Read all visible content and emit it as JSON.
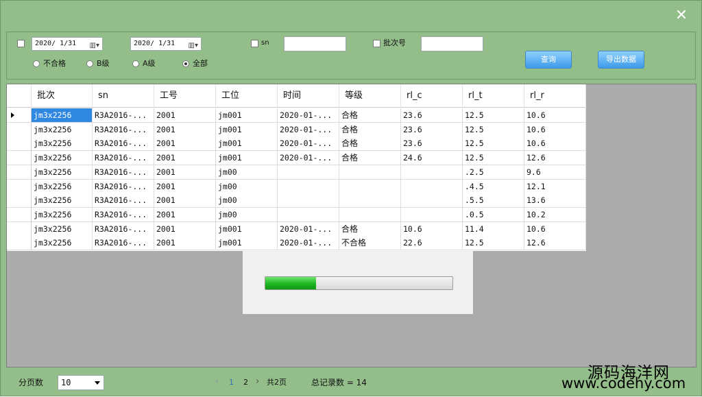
{
  "window": {
    "close_glyph": "✕"
  },
  "filter": {
    "date_start": "2020/ 1/31",
    "date_end": "2020/ 1/31",
    "sn_label": "sn",
    "sn_value": "",
    "batch_label": "批次号",
    "batch_value": "",
    "radios": [
      {
        "label": "不合格",
        "checked": false
      },
      {
        "label": "B级",
        "checked": false
      },
      {
        "label": "A级",
        "checked": false
      },
      {
        "label": "全部",
        "checked": true
      }
    ],
    "query_button": "查询",
    "export_button": "导出数据"
  },
  "grid": {
    "columns": [
      "批次",
      "sn",
      "工号",
      "工位",
      "时间",
      "等级",
      "rl_c",
      "rl_t",
      "rl_r"
    ],
    "rows": [
      [
        "jm3x2256",
        "R3A2016-...",
        "2001",
        "jm001",
        "2020-01-...",
        "合格",
        "23.6",
        "12.5",
        "10.6"
      ],
      [
        "jm3x2256",
        "R3A2016-...",
        "2001",
        "jm001",
        "2020-01-...",
        "合格",
        "23.6",
        "12.5",
        "10.6"
      ],
      [
        "jm3x2256",
        "R3A2016-...",
        "2001",
        "jm001",
        "2020-01-...",
        "合格",
        "23.6",
        "12.5",
        "10.6"
      ],
      [
        "jm3x2256",
        "R3A2016-...",
        "2001",
        "jm001",
        "2020-01-...",
        "合格",
        "24.6",
        "12.5",
        "12.6"
      ],
      [
        "jm3x2256",
        "R3A2016-...",
        "2001",
        "jm00",
        "",
        "",
        "",
        ".2.5",
        "9.6"
      ],
      [
        "jm3x2256",
        "R3A2016-...",
        "2001",
        "jm00",
        "",
        "",
        "",
        ".4.5",
        "12.1"
      ],
      [
        "jm3x2256",
        "R3A2016-...",
        "2001",
        "jm00",
        "",
        "",
        "",
        ".5.5",
        "13.6"
      ],
      [
        "jm3x2256",
        "R3A2016-...",
        "2001",
        "jm00",
        "",
        "",
        "",
        ".0.5",
        "10.2"
      ],
      [
        "jm3x2256",
        "R3A2016-...",
        "2001",
        "jm001",
        "2020-01-...",
        "合格",
        "10.6",
        "11.4",
        "10.6"
      ],
      [
        "jm3x2256",
        "R3A2016-...",
        "2001",
        "jm001",
        "2020-01-...",
        "不合格",
        "22.6",
        "12.5",
        "12.6"
      ]
    ]
  },
  "progress": {
    "value": 0.27
  },
  "footer": {
    "page_size_label": "分页数",
    "page_size_value": "10",
    "prev": "‹",
    "page1": "1",
    "page2": "2",
    "next": "›",
    "total_pages": "共2页",
    "total_records": "总记录数 = 14"
  },
  "watermark": {
    "line1": "源码海洋网",
    "line2": "www.codehy.com"
  }
}
